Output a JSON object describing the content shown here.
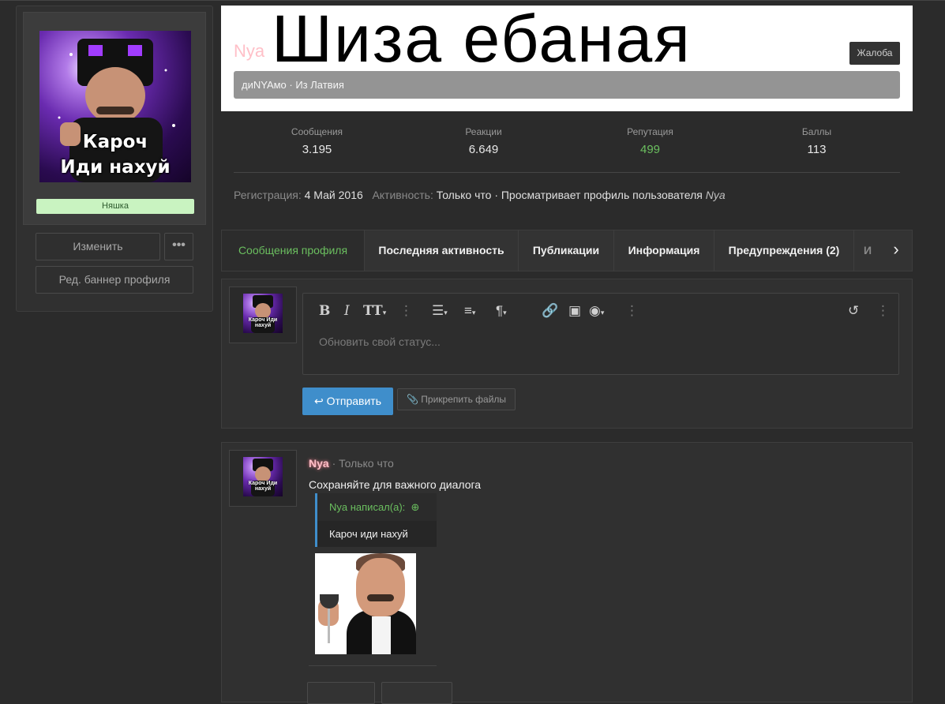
{
  "sidebar": {
    "avatar_caption_line1": "Кароч",
    "avatar_caption_line2": "Иди нахуй",
    "user_title": "Няшка",
    "edit_label": "Изменить",
    "more_label": "•••",
    "banner_label": "Ред. баннер профиля"
  },
  "header": {
    "username": "Nya",
    "banner_text": "Шиза ебаная",
    "report_label": "Жалоба",
    "bio": "диNYAмо · Из Латвия"
  },
  "stats": [
    {
      "label": "Сообщения",
      "value": "3.195"
    },
    {
      "label": "Реакции",
      "value": "6.649"
    },
    {
      "label": "Репутация",
      "value": "499"
    },
    {
      "label": "Баллы",
      "value": "113"
    }
  ],
  "reginfo": {
    "reg_label": "Регистрация:",
    "reg_date": "4 Май 2016",
    "activity_label": "Активность:",
    "activity_value": "Только что · Просматривает профиль пользователя",
    "activity_target": "Nya"
  },
  "tabs": [
    {
      "label": "Сообщения профиля"
    },
    {
      "label": "Последняя активность"
    },
    {
      "label": "Публикации"
    },
    {
      "label": "Информация"
    },
    {
      "label": "Предупреждения (2)"
    },
    {
      "label": "И"
    }
  ],
  "editor": {
    "placeholder": "Обновить свой статус...",
    "send_label": "Отправить",
    "attach_label": "Прикрепить файлы",
    "avatar_caption": "Кароч Иди нахуй"
  },
  "post": {
    "author": "Nya",
    "time": "· Только что",
    "text": "Сохраняйте для важного диалога",
    "quote_head": "Nya написал(а):",
    "quote_text": "Кароч иди нахуй"
  },
  "colors": {
    "accent_green": "#6bbf5f",
    "accent_blue": "#3f8ecb",
    "username_pink": "#ffc0c8",
    "user_title_bg": "#c9f3c1"
  }
}
